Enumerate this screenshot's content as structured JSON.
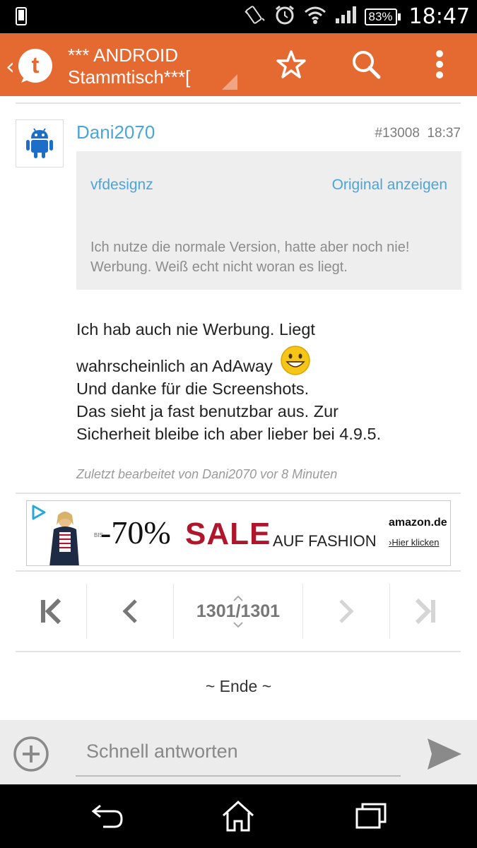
{
  "status_bar": {
    "battery": "83%",
    "time": "18:47",
    "icons": [
      "phone-icon",
      "vibrate-icon",
      "alarm-icon",
      "wifi-icon",
      "signal-icon",
      "battery-icon"
    ]
  },
  "action_bar": {
    "title": "*** ANDROID Stammtisch***[",
    "icons": [
      "back-icon",
      "tapatalk-logo",
      "star-icon",
      "search-icon",
      "overflow-menu-icon"
    ],
    "color": "#e56a32"
  },
  "post": {
    "author": "Dani2070",
    "number": "#13008",
    "time": "18:37",
    "quote": {
      "author": "vfdesignz",
      "link": "Original anzeigen",
      "text": "Ich nutze die normale Version, hatte aber noch nie! Werbung. Weiß echt nicht woran es liegt."
    },
    "body": {
      "line1": "Ich hab auch nie Werbung. Liegt",
      "line2": "wahrscheinlich an AdAway",
      "line3": "Und danke für die Screenshots.",
      "line4": "Das sieht ja fast benutzbar aus. Zur",
      "line5": "Sicherheit bleibe ich aber lieber bei 4.9.5."
    },
    "edited": "Zuletzt bearbeitet von Dani2070 vor 8 Minuten"
  },
  "ad": {
    "prefix": "BIS",
    "discount": "-70%",
    "sale": "SALE",
    "sub": "AUF FASHION",
    "brand": "amazon.de",
    "cta": "›Hier klicken"
  },
  "pager": {
    "count": "1301/1301"
  },
  "end_label": "~ Ende ~",
  "reply": {
    "placeholder": "Schnell antworten"
  }
}
